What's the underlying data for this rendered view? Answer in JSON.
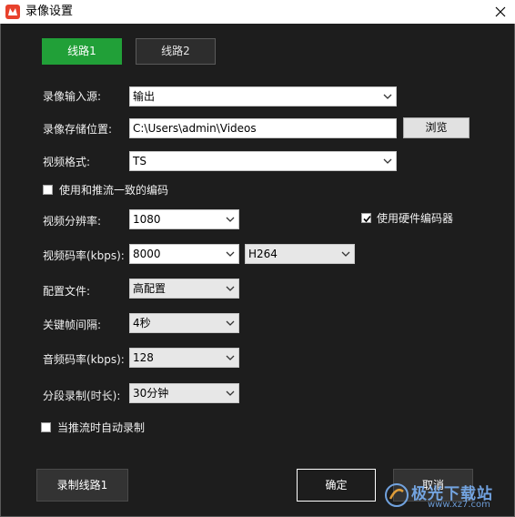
{
  "window": {
    "title": "录像设置",
    "icon": "app-logo-icon",
    "accent": "#21a038"
  },
  "tabs": [
    {
      "label": "线路1",
      "active": true
    },
    {
      "label": "线路2",
      "active": false
    }
  ],
  "form": {
    "source_label": "录像输入源:",
    "source_value": "输出",
    "path_label": "录像存储位置:",
    "path_value": "C:\\Users\\admin\\Videos",
    "browse_label": "浏览",
    "format_label": "视频格式:",
    "format_value": "TS",
    "same_encoding_label": "使用和推流一致的编码",
    "same_encoding_checked": false,
    "resolution_label": "视频分辨率:",
    "resolution_value": "1080",
    "hw_encoder_label": "使用硬件编码器",
    "hw_encoder_checked": true,
    "bitrate_label": "视频码率(kbps):",
    "bitrate_value": "8000",
    "codec_value": "H264",
    "profile_label": "配置文件:",
    "profile_value": "高配置",
    "keyframe_label": "关键帧间隔:",
    "keyframe_value": "4秒",
    "audio_bitrate_label": "音频码率(kbps):",
    "audio_bitrate_value": "128",
    "segment_label": "分段录制(时长):",
    "segment_value": "30分钟",
    "auto_record_label": "当推流时自动录制",
    "auto_record_checked": false
  },
  "footer": {
    "record_label": "录制线路1",
    "ok_label": "确定",
    "cancel_label": "取消"
  },
  "watermark": {
    "text": "极光下载站",
    "sub": "www.xz7.com"
  }
}
